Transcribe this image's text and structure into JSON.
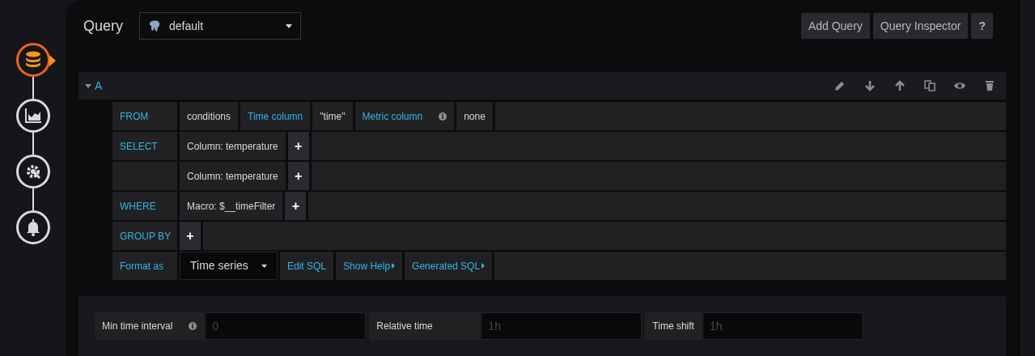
{
  "steps": [
    {
      "selected": true
    },
    {
      "selected": false
    },
    {
      "selected": false
    },
    {
      "selected": false
    }
  ],
  "header": {
    "title": "Query",
    "datasource": "default",
    "buttons": [
      "Add Query",
      "Query Inspector",
      "?"
    ]
  },
  "query": {
    "name": "A",
    "expanded": true,
    "rows": [
      {
        "keyword": "FROM",
        "parts": [
          {
            "kind": "value",
            "text": "conditions"
          },
          {
            "kind": "label",
            "text": "Time column"
          },
          {
            "kind": "value",
            "text": "\"time\""
          },
          {
            "kind": "label",
            "text": "Metric column",
            "info": true
          },
          {
            "kind": "value",
            "text": "none"
          }
        ]
      },
      {
        "keyword": "SELECT",
        "parts": [
          {
            "kind": "value",
            "text": "Column: temperature"
          },
          {
            "kind": "add",
            "text": "+"
          }
        ]
      },
      {
        "parts": [
          {
            "kind": "value",
            "text": "Column: temperature"
          },
          {
            "kind": "add",
            "text": "+"
          }
        ]
      },
      {
        "keyword": "WHERE",
        "parts": [
          {
            "kind": "value",
            "text": "Macro: $__timeFilter"
          },
          {
            "kind": "add",
            "text": "+"
          }
        ]
      },
      {
        "keyword": "GROUP BY",
        "parts": [
          {
            "kind": "add",
            "text": "+"
          }
        ]
      },
      {
        "keyword": "Format as",
        "parts": [
          {
            "kind": "select",
            "text": "Time series"
          },
          {
            "kind": "link",
            "text": "Edit SQL",
            "caret": false
          },
          {
            "kind": "link",
            "text": "Show Help",
            "caret": true
          },
          {
            "kind": "link",
            "text": "Generated SQL",
            "caret": true
          }
        ]
      }
    ]
  },
  "options": [
    {
      "label": "Min time interval",
      "info": true,
      "placeholder": "0"
    },
    {
      "label": "Relative time",
      "info": false,
      "placeholder": "1h"
    },
    {
      "label": "Time shift",
      "info": false,
      "placeholder": "1h"
    }
  ]
}
